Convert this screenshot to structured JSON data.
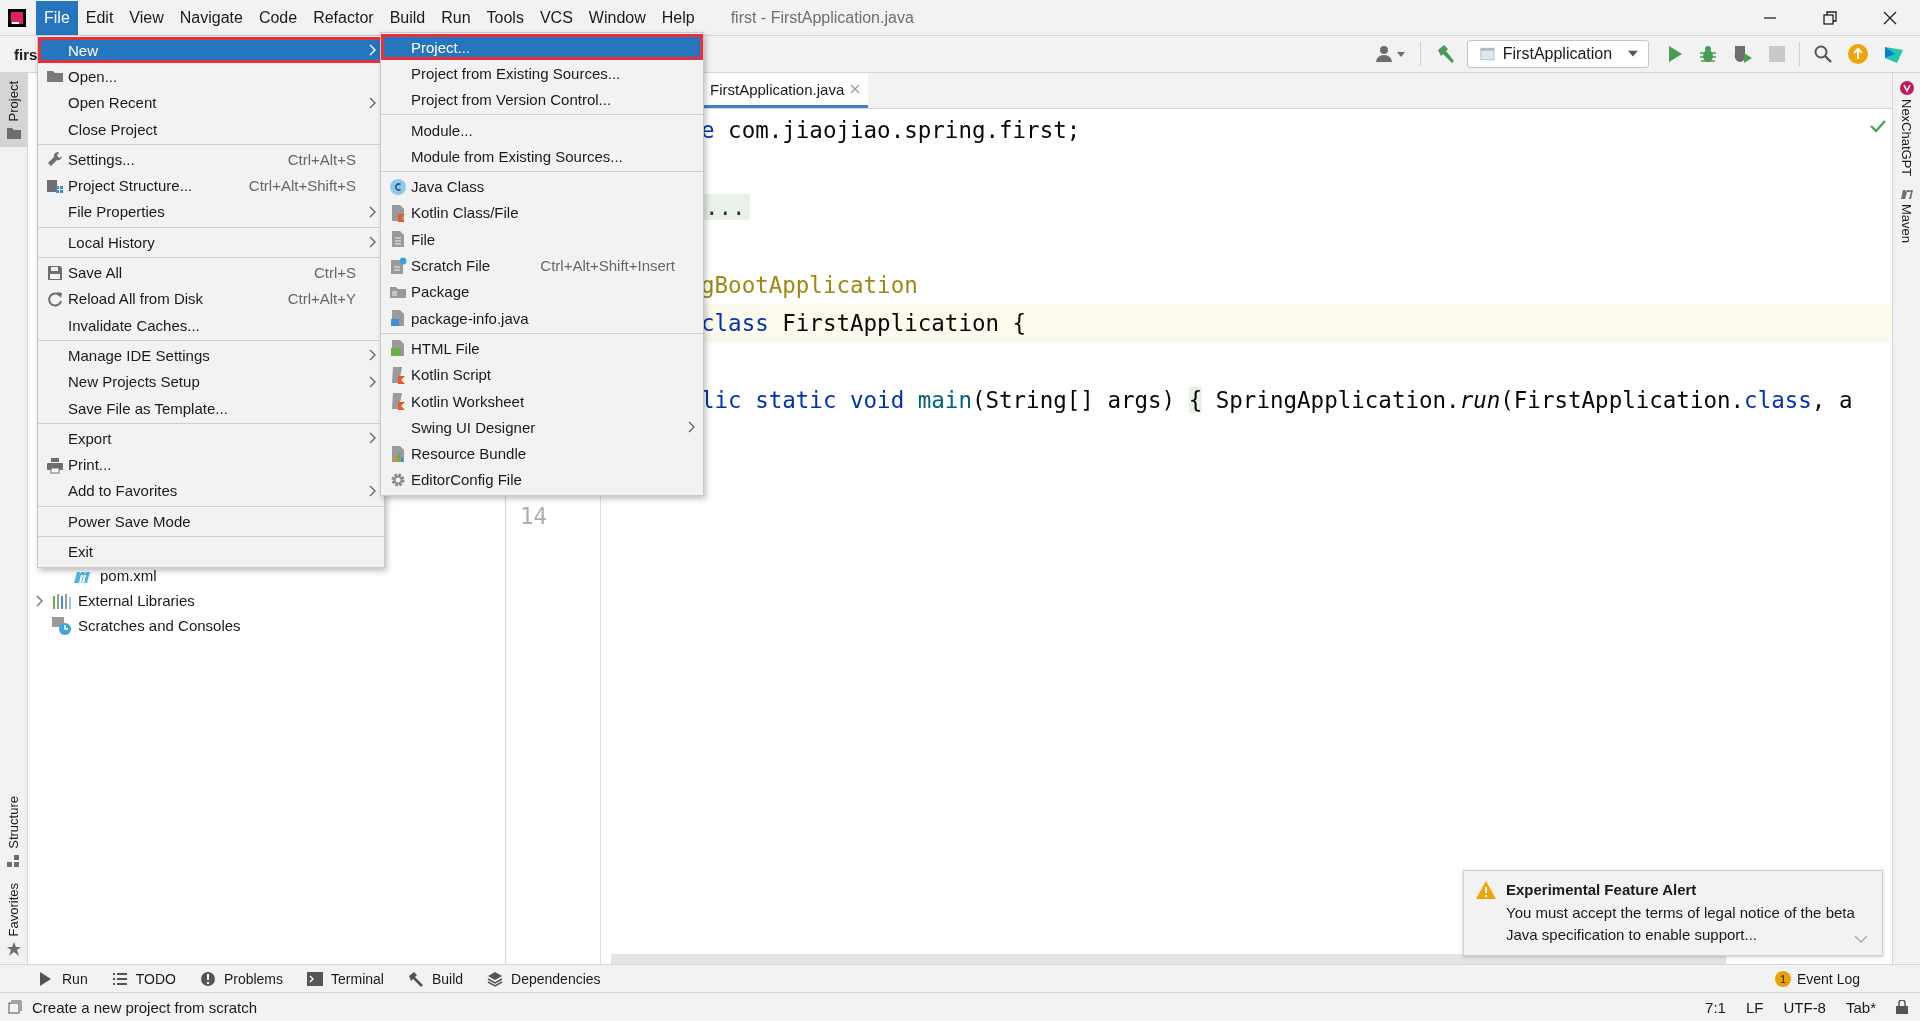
{
  "window": {
    "title": "first - FirstApplication.java"
  },
  "menu_bar": [
    {
      "label": "File",
      "selected": true
    },
    {
      "label": "Edit",
      "selected": false
    },
    {
      "label": "View",
      "selected": false
    },
    {
      "label": "Navigate",
      "selected": false
    },
    {
      "label": "Code",
      "selected": false
    },
    {
      "label": "Refactor",
      "selected": false
    },
    {
      "label": "Build",
      "selected": false
    },
    {
      "label": "Run",
      "selected": false
    },
    {
      "label": "Tools",
      "selected": false
    },
    {
      "label": "VCS",
      "selected": false
    },
    {
      "label": "Window",
      "selected": false
    },
    {
      "label": "Help",
      "selected": false
    }
  ],
  "navigation_bar": {
    "project": "firs",
    "run_configuration": "FirstApplication"
  },
  "left_stripe": [
    {
      "label": "Project",
      "selected": true
    },
    {
      "label": "Structure",
      "selected": false
    },
    {
      "label": "Favorites",
      "selected": false
    }
  ],
  "project_tree": [
    {
      "label": "pom.xml"
    },
    {
      "label": "External Libraries",
      "expanded": false
    },
    {
      "label": "Scratches and Consoles"
    }
  ],
  "editor": {
    "tabs": [
      {
        "label": "FirstApplication.java",
        "selected": true
      }
    ],
    "lines": [
      {
        "kind": "code",
        "tokens": [
          {
            "kind": "keyword",
            "text": "e"
          },
          {
            "kind": "plain",
            "text": " com.jiaojiao.spring.first;"
          }
        ]
      },
      {
        "kind": "blank"
      },
      {
        "kind": "code",
        "tokens": [
          {
            "kind": "fold",
            "text": "..."
          }
        ]
      },
      {
        "kind": "blank"
      },
      {
        "kind": "code",
        "tokens": [
          {
            "kind": "annotation",
            "text": "gBootApplication"
          }
        ]
      },
      {
        "kind": "code",
        "current": true,
        "tokens": [
          {
            "kind": "keyword",
            "text": "class"
          },
          {
            "kind": "plain",
            "text": " FirstApplication {"
          }
        ]
      },
      {
        "kind": "blank"
      },
      {
        "kind": "code",
        "tokens": [
          {
            "kind": "keyword",
            "text": "lic static void "
          },
          {
            "kind": "declaration",
            "text": "main"
          },
          {
            "kind": "plain",
            "text": "(String[] args) "
          },
          {
            "kind": "brace",
            "text": "{"
          },
          {
            "kind": "plain",
            "text": " SpringApplication."
          },
          {
            "kind": "italic",
            "text": "run"
          },
          {
            "kind": "plain",
            "text": "(FirstApplication."
          },
          {
            "kind": "keyword",
            "text": "class"
          },
          {
            "kind": "plain",
            "text": ", a"
          }
        ]
      },
      {
        "kind": "blank"
      },
      {
        "kind": "blank"
      },
      {
        "kind": "blank",
        "number": "14"
      }
    ]
  },
  "right_stripe": [
    {
      "label": "NexChatGPT"
    },
    {
      "label": "Maven"
    }
  ],
  "file_menu": [
    {
      "kind": "item",
      "label": "New",
      "selected": true,
      "marked": true,
      "has_submenu": true
    },
    {
      "kind": "item",
      "label": "Open...",
      "selected": false,
      "marked": false,
      "has_submenu": false
    },
    {
      "kind": "item",
      "label": "Open Recent",
      "selected": false,
      "marked": false,
      "has_submenu": true
    },
    {
      "kind": "item",
      "label": "Close Project",
      "selected": false,
      "marked": false,
      "has_submenu": false
    },
    {
      "kind": "separator"
    },
    {
      "kind": "item",
      "label": "Settings...",
      "shortcut": "Ctrl+Alt+S",
      "selected": false,
      "marked": false,
      "has_submenu": false
    },
    {
      "kind": "item",
      "label": "Project Structure...",
      "shortcut": "Ctrl+Alt+Shift+S",
      "selected": false,
      "marked": false,
      "has_submenu": false
    },
    {
      "kind": "item",
      "label": "File Properties",
      "selected": false,
      "marked": false,
      "has_submenu": true
    },
    {
      "kind": "separator"
    },
    {
      "kind": "item",
      "label": "Local History",
      "selected": false,
      "marked": false,
      "has_submenu": true
    },
    {
      "kind": "separator"
    },
    {
      "kind": "item",
      "label": "Save All",
      "shortcut": "Ctrl+S",
      "selected": false,
      "marked": false,
      "has_submenu": false
    },
    {
      "kind": "item",
      "label": "Reload All from Disk",
      "shortcut": "Ctrl+Alt+Y",
      "selected": false,
      "marked": false,
      "has_submenu": false
    },
    {
      "kind": "item",
      "label": "Invalidate Caches...",
      "selected": false,
      "marked": false,
      "has_submenu": false
    },
    {
      "kind": "separator"
    },
    {
      "kind": "item",
      "label": "Manage IDE Settings",
      "selected": false,
      "marked": false,
      "has_submenu": true
    },
    {
      "kind": "item",
      "label": "New Projects Setup",
      "selected": false,
      "marked": false,
      "has_submenu": true
    },
    {
      "kind": "item",
      "label": "Save File as Template...",
      "selected": false,
      "marked": false,
      "has_submenu": false
    },
    {
      "kind": "separator"
    },
    {
      "kind": "item",
      "label": "Export",
      "selected": false,
      "marked": false,
      "has_submenu": true
    },
    {
      "kind": "item",
      "label": "Print...",
      "selected": false,
      "marked": false,
      "has_submenu": false
    },
    {
      "kind": "item",
      "label": "Add to Favorites",
      "selected": false,
      "marked": false,
      "has_submenu": true
    },
    {
      "kind": "separator"
    },
    {
      "kind": "item",
      "label": "Power Save Mode",
      "selected": false,
      "marked": false,
      "has_submenu": false
    },
    {
      "kind": "separator"
    },
    {
      "kind": "item",
      "label": "Exit",
      "selected": false,
      "marked": false,
      "has_submenu": false
    }
  ],
  "new_submenu": [
    {
      "kind": "item",
      "label": "Project...",
      "selected": true,
      "marked": true,
      "has_submenu": false
    },
    {
      "kind": "item",
      "label": "Project from Existing Sources...",
      "selected": false,
      "marked": false,
      "has_submenu": false
    },
    {
      "kind": "item",
      "label": "Project from Version Control...",
      "selected": false,
      "marked": false,
      "has_submenu": false
    },
    {
      "kind": "separator"
    },
    {
      "kind": "item",
      "label": "Module...",
      "selected": false,
      "marked": false,
      "has_submenu": false
    },
    {
      "kind": "item",
      "label": "Module from Existing Sources...",
      "selected": false,
      "marked": false,
      "has_submenu": false
    },
    {
      "kind": "separator"
    },
    {
      "kind": "item",
      "label": "Java Class",
      "selected": false,
      "marked": false,
      "has_submenu": false
    },
    {
      "kind": "item",
      "label": "Kotlin Class/File",
      "selected": false,
      "marked": false,
      "has_submenu": false
    },
    {
      "kind": "item",
      "label": "File",
      "selected": false,
      "marked": false,
      "has_submenu": false
    },
    {
      "kind": "item",
      "label": "Scratch File",
      "shortcut": "Ctrl+Alt+Shift+Insert",
      "selected": false,
      "marked": false,
      "has_submenu": false
    },
    {
      "kind": "item",
      "label": "Package",
      "selected": false,
      "marked": false,
      "has_submenu": false
    },
    {
      "kind": "item",
      "label": "package-info.java",
      "selected": false,
      "marked": false,
      "has_submenu": false
    },
    {
      "kind": "separator"
    },
    {
      "kind": "item",
      "label": "HTML File",
      "selected": false,
      "marked": false,
      "has_submenu": false
    },
    {
      "kind": "item",
      "label": "Kotlin Script",
      "selected": false,
      "marked": false,
      "has_submenu": false
    },
    {
      "kind": "item",
      "label": "Kotlin Worksheet",
      "selected": false,
      "marked": false,
      "has_submenu": false
    },
    {
      "kind": "item",
      "label": "Swing UI Designer",
      "selected": false,
      "marked": false,
      "has_submenu": true
    },
    {
      "kind": "item",
      "label": "Resource Bundle",
      "selected": false,
      "marked": false,
      "has_submenu": false
    },
    {
      "kind": "item",
      "label": "EditorConfig File",
      "selected": false,
      "marked": false,
      "has_submenu": false
    }
  ],
  "notification": {
    "title": "Experimental Feature Alert",
    "message": "You must accept the terms of legal notice of the beta Java specification to enable support..."
  },
  "tool_windows": [
    {
      "label": "Run"
    },
    {
      "label": "TODO"
    },
    {
      "label": "Problems"
    },
    {
      "label": "Terminal"
    },
    {
      "label": "Build"
    },
    {
      "label": "Dependencies"
    }
  ],
  "event_log": {
    "label": "Event Log",
    "badge": "1"
  },
  "status_bar": {
    "message": "Create a new project from scratch",
    "position": "7:1",
    "line_separator": "LF",
    "encoding": "UTF-8",
    "indent": "Tab*"
  }
}
